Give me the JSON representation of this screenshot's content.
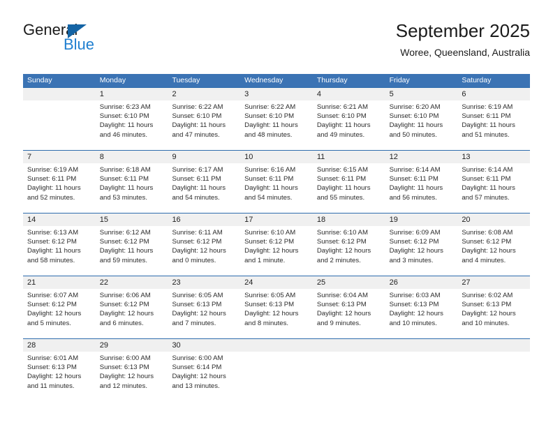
{
  "brand": {
    "name_part1": "General",
    "name_part2": "Blue",
    "logo_icon": "triangle-icon",
    "accent_color": "#1f7fd0",
    "triangle_color": "#1464a5"
  },
  "header": {
    "title": "September 2025",
    "subtitle": "Woree, Queensland, Australia"
  },
  "theme": {
    "header_row_bg": "#3b73b4",
    "daynum_band_bg": "#f0f0f0",
    "week_divider": "#2e6cad"
  },
  "weekdays": [
    "Sunday",
    "Monday",
    "Tuesday",
    "Wednesday",
    "Thursday",
    "Friday",
    "Saturday"
  ],
  "weeks": [
    {
      "days": [
        {
          "num": "",
          "sunrise": "",
          "sunset": "",
          "daylight1": "",
          "daylight2": "",
          "empty": true
        },
        {
          "num": "1",
          "sunrise": "Sunrise: 6:23 AM",
          "sunset": "Sunset: 6:10 PM",
          "daylight1": "Daylight: 11 hours",
          "daylight2": "and 46 minutes."
        },
        {
          "num": "2",
          "sunrise": "Sunrise: 6:22 AM",
          "sunset": "Sunset: 6:10 PM",
          "daylight1": "Daylight: 11 hours",
          "daylight2": "and 47 minutes."
        },
        {
          "num": "3",
          "sunrise": "Sunrise: 6:22 AM",
          "sunset": "Sunset: 6:10 PM",
          "daylight1": "Daylight: 11 hours",
          "daylight2": "and 48 minutes."
        },
        {
          "num": "4",
          "sunrise": "Sunrise: 6:21 AM",
          "sunset": "Sunset: 6:10 PM",
          "daylight1": "Daylight: 11 hours",
          "daylight2": "and 49 minutes."
        },
        {
          "num": "5",
          "sunrise": "Sunrise: 6:20 AM",
          "sunset": "Sunset: 6:10 PM",
          "daylight1": "Daylight: 11 hours",
          "daylight2": "and 50 minutes."
        },
        {
          "num": "6",
          "sunrise": "Sunrise: 6:19 AM",
          "sunset": "Sunset: 6:11 PM",
          "daylight1": "Daylight: 11 hours",
          "daylight2": "and 51 minutes."
        }
      ]
    },
    {
      "days": [
        {
          "num": "7",
          "sunrise": "Sunrise: 6:19 AM",
          "sunset": "Sunset: 6:11 PM",
          "daylight1": "Daylight: 11 hours",
          "daylight2": "and 52 minutes."
        },
        {
          "num": "8",
          "sunrise": "Sunrise: 6:18 AM",
          "sunset": "Sunset: 6:11 PM",
          "daylight1": "Daylight: 11 hours",
          "daylight2": "and 53 minutes."
        },
        {
          "num": "9",
          "sunrise": "Sunrise: 6:17 AM",
          "sunset": "Sunset: 6:11 PM",
          "daylight1": "Daylight: 11 hours",
          "daylight2": "and 54 minutes."
        },
        {
          "num": "10",
          "sunrise": "Sunrise: 6:16 AM",
          "sunset": "Sunset: 6:11 PM",
          "daylight1": "Daylight: 11 hours",
          "daylight2": "and 54 minutes."
        },
        {
          "num": "11",
          "sunrise": "Sunrise: 6:15 AM",
          "sunset": "Sunset: 6:11 PM",
          "daylight1": "Daylight: 11 hours",
          "daylight2": "and 55 minutes."
        },
        {
          "num": "12",
          "sunrise": "Sunrise: 6:14 AM",
          "sunset": "Sunset: 6:11 PM",
          "daylight1": "Daylight: 11 hours",
          "daylight2": "and 56 minutes."
        },
        {
          "num": "13",
          "sunrise": "Sunrise: 6:14 AM",
          "sunset": "Sunset: 6:11 PM",
          "daylight1": "Daylight: 11 hours",
          "daylight2": "and 57 minutes."
        }
      ]
    },
    {
      "days": [
        {
          "num": "14",
          "sunrise": "Sunrise: 6:13 AM",
          "sunset": "Sunset: 6:12 PM",
          "daylight1": "Daylight: 11 hours",
          "daylight2": "and 58 minutes."
        },
        {
          "num": "15",
          "sunrise": "Sunrise: 6:12 AM",
          "sunset": "Sunset: 6:12 PM",
          "daylight1": "Daylight: 11 hours",
          "daylight2": "and 59 minutes."
        },
        {
          "num": "16",
          "sunrise": "Sunrise: 6:11 AM",
          "sunset": "Sunset: 6:12 PM",
          "daylight1": "Daylight: 12 hours",
          "daylight2": "and 0 minutes."
        },
        {
          "num": "17",
          "sunrise": "Sunrise: 6:10 AM",
          "sunset": "Sunset: 6:12 PM",
          "daylight1": "Daylight: 12 hours",
          "daylight2": "and 1 minute."
        },
        {
          "num": "18",
          "sunrise": "Sunrise: 6:10 AM",
          "sunset": "Sunset: 6:12 PM",
          "daylight1": "Daylight: 12 hours",
          "daylight2": "and 2 minutes."
        },
        {
          "num": "19",
          "sunrise": "Sunrise: 6:09 AM",
          "sunset": "Sunset: 6:12 PM",
          "daylight1": "Daylight: 12 hours",
          "daylight2": "and 3 minutes."
        },
        {
          "num": "20",
          "sunrise": "Sunrise: 6:08 AM",
          "sunset": "Sunset: 6:12 PM",
          "daylight1": "Daylight: 12 hours",
          "daylight2": "and 4 minutes."
        }
      ]
    },
    {
      "days": [
        {
          "num": "21",
          "sunrise": "Sunrise: 6:07 AM",
          "sunset": "Sunset: 6:12 PM",
          "daylight1": "Daylight: 12 hours",
          "daylight2": "and 5 minutes."
        },
        {
          "num": "22",
          "sunrise": "Sunrise: 6:06 AM",
          "sunset": "Sunset: 6:12 PM",
          "daylight1": "Daylight: 12 hours",
          "daylight2": "and 6 minutes."
        },
        {
          "num": "23",
          "sunrise": "Sunrise: 6:05 AM",
          "sunset": "Sunset: 6:13 PM",
          "daylight1": "Daylight: 12 hours",
          "daylight2": "and 7 minutes."
        },
        {
          "num": "24",
          "sunrise": "Sunrise: 6:05 AM",
          "sunset": "Sunset: 6:13 PM",
          "daylight1": "Daylight: 12 hours",
          "daylight2": "and 8 minutes."
        },
        {
          "num": "25",
          "sunrise": "Sunrise: 6:04 AM",
          "sunset": "Sunset: 6:13 PM",
          "daylight1": "Daylight: 12 hours",
          "daylight2": "and 9 minutes."
        },
        {
          "num": "26",
          "sunrise": "Sunrise: 6:03 AM",
          "sunset": "Sunset: 6:13 PM",
          "daylight1": "Daylight: 12 hours",
          "daylight2": "and 10 minutes."
        },
        {
          "num": "27",
          "sunrise": "Sunrise: 6:02 AM",
          "sunset": "Sunset: 6:13 PM",
          "daylight1": "Daylight: 12 hours",
          "daylight2": "and 10 minutes."
        }
      ]
    },
    {
      "days": [
        {
          "num": "28",
          "sunrise": "Sunrise: 6:01 AM",
          "sunset": "Sunset: 6:13 PM",
          "daylight1": "Daylight: 12 hours",
          "daylight2": "and 11 minutes."
        },
        {
          "num": "29",
          "sunrise": "Sunrise: 6:00 AM",
          "sunset": "Sunset: 6:13 PM",
          "daylight1": "Daylight: 12 hours",
          "daylight2": "and 12 minutes."
        },
        {
          "num": "30",
          "sunrise": "Sunrise: 6:00 AM",
          "sunset": "Sunset: 6:14 PM",
          "daylight1": "Daylight: 12 hours",
          "daylight2": "and 13 minutes."
        },
        {
          "num": "",
          "sunrise": "",
          "sunset": "",
          "daylight1": "",
          "daylight2": "",
          "empty": true
        },
        {
          "num": "",
          "sunrise": "",
          "sunset": "",
          "daylight1": "",
          "daylight2": "",
          "empty": true
        },
        {
          "num": "",
          "sunrise": "",
          "sunset": "",
          "daylight1": "",
          "daylight2": "",
          "empty": true
        },
        {
          "num": "",
          "sunrise": "",
          "sunset": "",
          "daylight1": "",
          "daylight2": "",
          "empty": true
        }
      ]
    }
  ]
}
